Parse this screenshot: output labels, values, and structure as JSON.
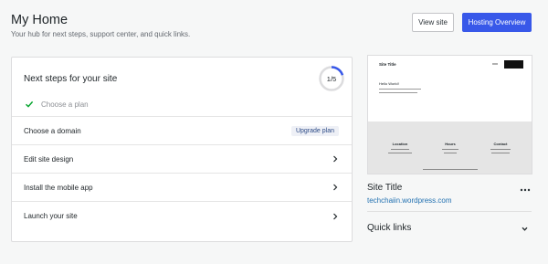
{
  "header": {
    "title": "My Home",
    "subtitle": "Your hub for next steps, support center, and quick links."
  },
  "actions": {
    "view_site": "View site",
    "hosting_overview": "Hosting Overview"
  },
  "next_steps": {
    "title": "Next steps for your site",
    "progress_label": "1/5",
    "progress_fraction": 0.2,
    "accent_color": "#3858e9",
    "completed": [
      {
        "label": "Choose a plan",
        "icon": "checkmark-icon"
      }
    ],
    "tasks": [
      {
        "label": "Choose a domain",
        "badge": "Upgrade plan"
      },
      {
        "label": "Edit site design",
        "icon": "chevron-right-icon"
      },
      {
        "label": "Install the mobile app",
        "icon": "chevron-right-icon"
      },
      {
        "label": "Launch your site",
        "icon": "chevron-right-icon"
      }
    ]
  },
  "site_card": {
    "preview": {
      "site_title": "Site Title",
      "heading": "Hello World!",
      "footer_columns": [
        {
          "heading": "Location"
        },
        {
          "heading": "Hours"
        },
        {
          "heading": "Contact"
        }
      ]
    },
    "title": "Site Title",
    "url": "techchaiin.wordpress.com",
    "more_icon": "ellipsis-icon"
  },
  "quick_links": {
    "title": "Quick links",
    "icon": "chevron-down-icon"
  }
}
